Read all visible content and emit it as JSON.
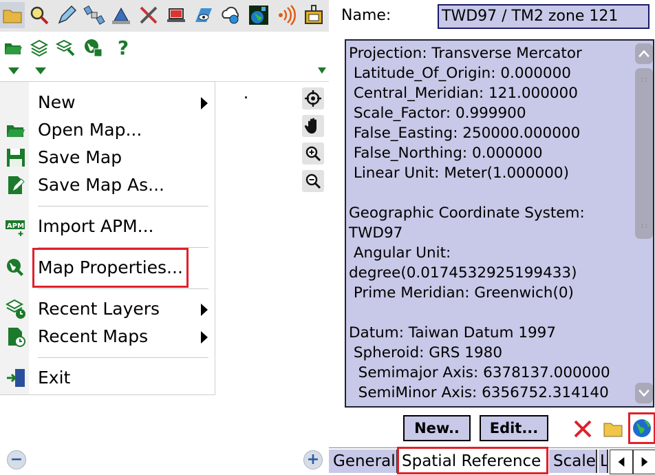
{
  "toolbar": {
    "icons": [
      "folder-icon",
      "search-icon",
      "pen-icon",
      "satellite-icon",
      "measure-icon",
      "tools-icon",
      "laptop-icon",
      "map-eye-icon",
      "cloud-globe-icon",
      "globe-satellite-icon",
      "signal-icon",
      "lock-panel-icon"
    ]
  },
  "toolbar2": {
    "icons": [
      "open-folder-icon",
      "add-layer-icon",
      "layer-tool-icon",
      "globe-save-icon",
      "help-icon"
    ],
    "help_label": "?"
  },
  "menu": {
    "items": [
      {
        "label": "New",
        "icon": "",
        "submenu": true
      },
      {
        "label": "Open Map...",
        "icon": "open-folder-icon",
        "submenu": false
      },
      {
        "label": "Save Map",
        "icon": "save-icon",
        "submenu": false
      },
      {
        "label": "Save Map As...",
        "icon": "save-as-icon",
        "submenu": false
      },
      {
        "label": "Import APM...",
        "icon": "apm-icon",
        "submenu": false
      },
      {
        "label": "Map Properties...",
        "icon": "map-properties-icon",
        "submenu": false
      },
      {
        "label": "Recent Layers",
        "icon": "recent-layers-icon",
        "submenu": true
      },
      {
        "label": "Recent Maps",
        "icon": "recent-maps-icon",
        "submenu": true
      },
      {
        "label": "Exit",
        "icon": "exit-icon",
        "submenu": false
      }
    ],
    "apm_badge": "APM"
  },
  "map_tools": [
    "target-icon",
    "hand-icon",
    "zoom-in-icon",
    "zoom-out-icon"
  ],
  "map_controls": {
    "minus": "−",
    "plus": "+"
  },
  "properties": {
    "name_label": "Name:",
    "name_value": "TWD97 / TM2 zone 121",
    "info_lines": [
      "Projection: Transverse Mercator",
      " Latitude_Of_Origin: 0.000000",
      " Central_Meridian: 121.000000",
      " Scale_Factor: 0.999900",
      " False_Easting: 250000.000000",
      " False_Northing: 0.000000",
      " Linear Unit: Meter(1.000000)",
      "",
      "Geographic Coordinate System:",
      "TWD97",
      " Angular Unit:",
      "degree(0.0174532925199433)",
      " Prime Meridian: Greenwich(0)",
      "",
      "Datum: Taiwan Datum 1997",
      " Spheroid: GRS 1980",
      "  Semimajor Axis: 6378137.000000",
      "  SemiMinor Axis: 6356752.314140"
    ],
    "new_button": "New..",
    "edit_button": "Edit..."
  },
  "tabs": [
    "General",
    "Spatial Reference",
    "Scale",
    "L"
  ],
  "colors": {
    "highlight": "#e0202a",
    "panel": "#c8c8e8",
    "icon_green": "#1b7a2b"
  }
}
